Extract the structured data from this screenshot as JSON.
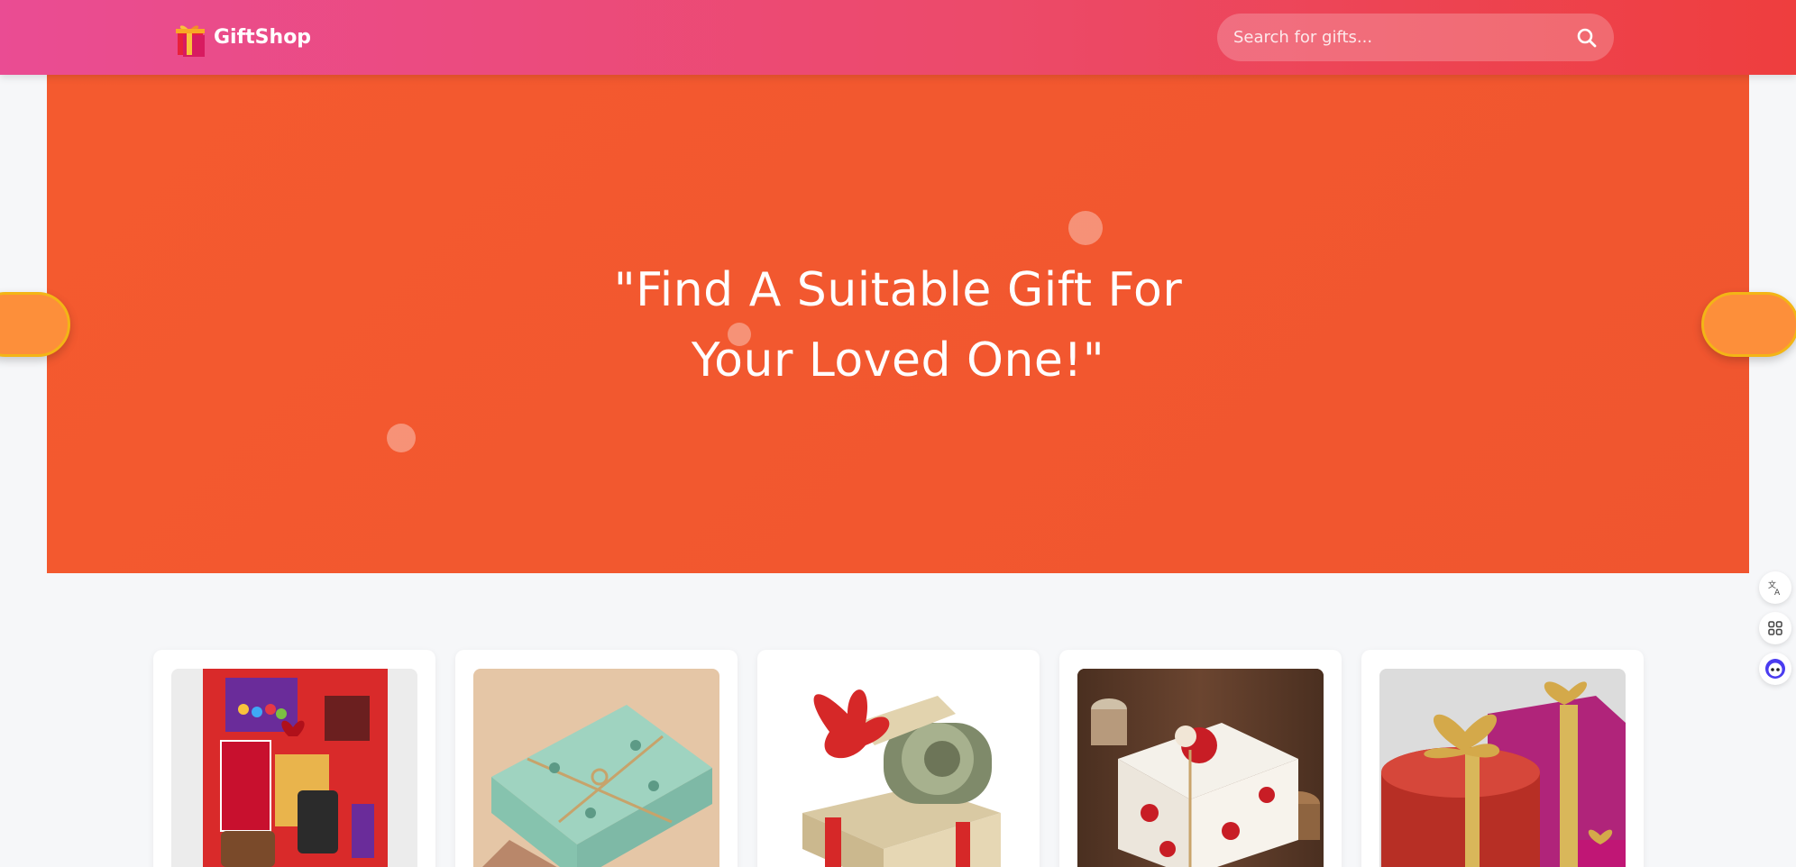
{
  "header": {
    "brand": "GiftShop",
    "search_placeholder": "Search for gifts..."
  },
  "hero": {
    "title": "\"Find A Suitable Gift For Your Loved One!\""
  },
  "side_tools": [
    {
      "icon": "translate-icon"
    },
    {
      "icon": "grid-icon"
    },
    {
      "icon": "assistant-face-icon"
    }
  ],
  "products": [
    {
      "image": "gift-basket-image"
    },
    {
      "image": "wrapped-box-image"
    },
    {
      "image": "money-gift-box-image"
    },
    {
      "image": "floral-gift-box-image"
    },
    {
      "image": "red-gold-gifts-image"
    }
  ],
  "colors": {
    "header_start": "#ea4c93",
    "header_end": "#ee3e3e",
    "hero": "#f45a2f",
    "arrow": "#fd8f3a"
  }
}
